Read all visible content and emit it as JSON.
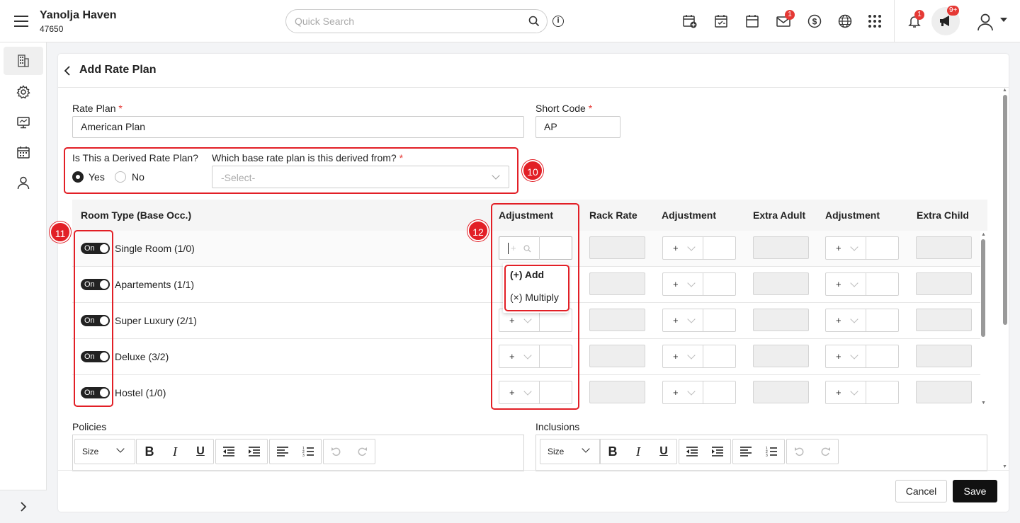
{
  "app": {
    "hotel_name": "Yanolja Haven",
    "hotel_code": "47650"
  },
  "search": {
    "placeholder": "Quick Search"
  },
  "toolbar": {
    "icons": [
      "calendar-add-icon",
      "calendar-check-icon",
      "calendar-icon",
      "mail-icon",
      "dollar-icon",
      "globe-icon",
      "apps-grid-icon"
    ],
    "mail_badge": "1",
    "notification_badge": "1",
    "announcement_badge": "9+"
  },
  "sidebar": {
    "items": [
      "building-icon",
      "gear-icon",
      "monitor-icon",
      "calendar-icon",
      "user-icon"
    ]
  },
  "page": {
    "title": "Add Rate Plan"
  },
  "form": {
    "rate_plan_label": "Rate Plan",
    "rate_plan_value": "American Plan",
    "short_code_label": "Short Code",
    "short_code_value": "AP",
    "derived_label": "Is This a Derived Rate Plan?",
    "yes_label": "Yes",
    "no_label": "No",
    "selected": "Yes",
    "base_label": "Which base rate plan is this derived from?",
    "base_placeholder": "-Select-",
    "required_mark": "*"
  },
  "callouts": {
    "c10": "10",
    "c11": "11",
    "c12": "12"
  },
  "table": {
    "headers": [
      "Room Type (Base Occ.)",
      "Adjustment",
      "Rack Rate",
      "Adjustment",
      "Extra Adult",
      "Adjustment",
      "Extra Child"
    ],
    "toggle_label": "On",
    "rows": [
      {
        "name": "Single Room (1/0)",
        "adj1": "+",
        "adj2": "+",
        "adj3": "+"
      },
      {
        "name": "Apartements (1/1)",
        "adj1": "+",
        "adj2": "+",
        "adj3": "+"
      },
      {
        "name": "Super Luxury (2/1)",
        "adj1": "+",
        "adj2": "+",
        "adj3": "+"
      },
      {
        "name": "Deluxe (3/2)",
        "adj1": "+",
        "adj2": "+",
        "adj3": "+"
      },
      {
        "name": "Hostel (1/0)",
        "adj1": "+",
        "adj2": "+",
        "adj3": "+"
      }
    ],
    "first_row_op": "+",
    "dropdown_options": [
      "(+) Add",
      "(×) Multiply"
    ]
  },
  "editors": {
    "policies_label": "Policies",
    "inclusions_label": "Inclusions",
    "size_label": "Size",
    "bold": "B",
    "italic": "I",
    "underline": "U"
  },
  "actions": {
    "cancel": "Cancel",
    "save": "Save"
  }
}
